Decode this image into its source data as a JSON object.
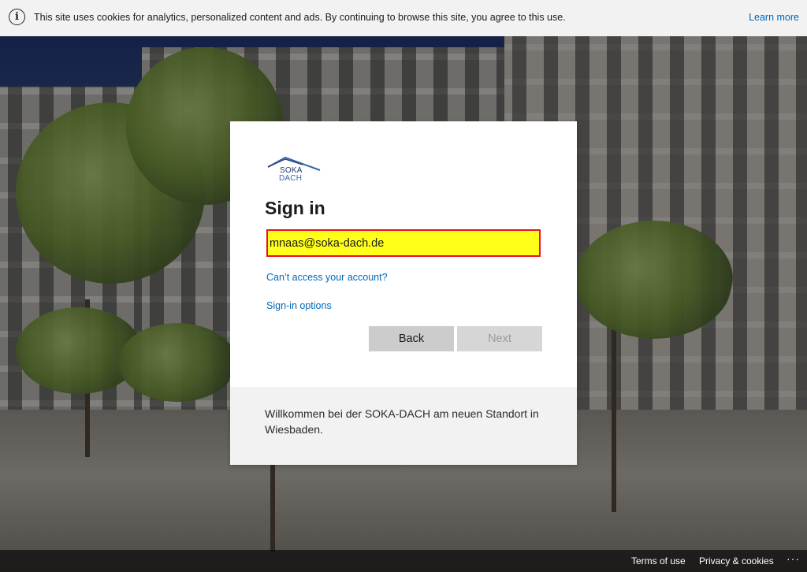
{
  "cookie_banner": {
    "icon": "info-icon",
    "text": "This site uses cookies for analytics, personalized content and ads. By continuing to browse this site, you agree to this use.",
    "learn_more": "Learn more"
  },
  "sign_in": {
    "logo_line1": "SOKA",
    "logo_line2": "DACH",
    "title": "Sign in",
    "email_value": "mnaas@soka-dach.de",
    "cant_access": "Can’t access your account?",
    "signin_options": "Sign-in options",
    "back_label": "Back",
    "next_label": "Next",
    "footer_text": "Willkommen bei der SOKA-DACH am neuen Standort in Wiesbaden."
  },
  "page_footer": {
    "terms": "Terms of use",
    "privacy": "Privacy & cookies",
    "more": "···"
  },
  "colors": {
    "accent_link": "#0067b8",
    "input_highlight": "#ffff1a",
    "input_border": "#e81123"
  }
}
